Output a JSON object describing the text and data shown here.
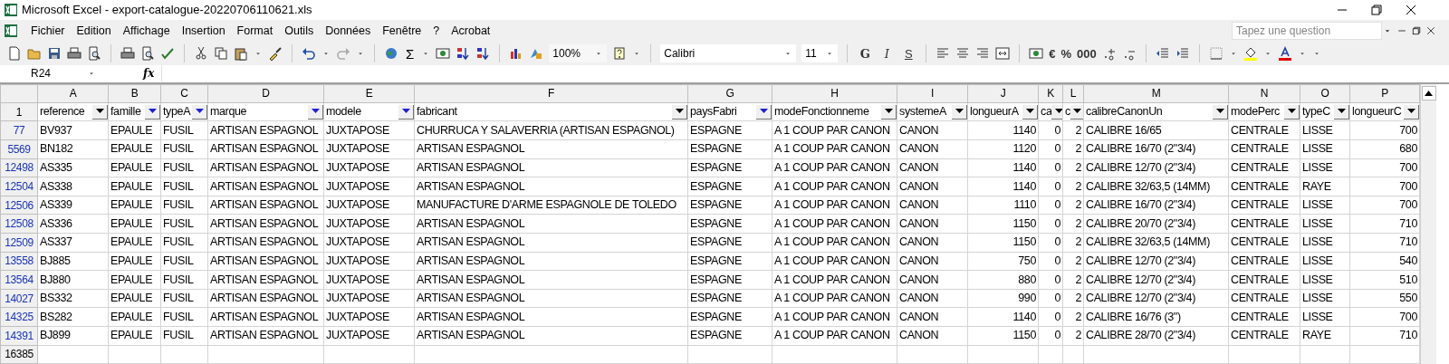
{
  "window": {
    "title": "Microsoft Excel - export-catalogue-20220706110621.xls"
  },
  "menu": [
    "Fichier",
    "Edition",
    "Affichage",
    "Insertion",
    "Format",
    "Outils",
    "Données",
    "Fenêtre",
    "?",
    "Acrobat"
  ],
  "help_search": {
    "placeholder": "Tapez une question"
  },
  "toolbar": {
    "zoom": "100%",
    "sigma": "Σ",
    "font": "Calibri",
    "size": "11",
    "format_buttons": [
      "G",
      "I",
      "S"
    ],
    "number_buttons": [
      "€",
      "%",
      "000"
    ]
  },
  "formula_bar": {
    "name_box": "R24",
    "fx": "fx"
  },
  "columns": [
    {
      "letter": "A",
      "header": "reference",
      "filtered": false,
      "numeric": false
    },
    {
      "letter": "B",
      "header": "famille",
      "filtered": true,
      "numeric": false
    },
    {
      "letter": "C",
      "header": "typeA",
      "filtered": true,
      "numeric": false
    },
    {
      "letter": "D",
      "header": "marque",
      "filtered": true,
      "numeric": false
    },
    {
      "letter": "E",
      "header": "modele",
      "filtered": true,
      "numeric": false
    },
    {
      "letter": "F",
      "header": "fabricant",
      "filtered": false,
      "numeric": false
    },
    {
      "letter": "G",
      "header": "paysFabri",
      "filtered": true,
      "numeric": false
    },
    {
      "letter": "H",
      "header": "modeFonctionneme",
      "filtered": false,
      "numeric": false
    },
    {
      "letter": "I",
      "header": "systemeA",
      "filtered": false,
      "numeric": false
    },
    {
      "letter": "J",
      "header": "longueurA",
      "filtered": false,
      "numeric": true
    },
    {
      "letter": "K",
      "header": "ca",
      "filtered": false,
      "numeric": true
    },
    {
      "letter": "L",
      "header": "c",
      "filtered": false,
      "numeric": true
    },
    {
      "letter": "M",
      "header": "calibreCanonUn",
      "filtered": false,
      "numeric": false
    },
    {
      "letter": "N",
      "header": "modePerc",
      "filtered": false,
      "numeric": false
    },
    {
      "letter": "O",
      "header": "typeC",
      "filtered": false,
      "numeric": false
    },
    {
      "letter": "P",
      "header": "longueurC",
      "filtered": false,
      "numeric": true
    }
  ],
  "header_row": "1",
  "rows": [
    {
      "row": "77",
      "filtered": true,
      "cells": [
        "BV937",
        "EPAULE",
        "FUSIL",
        "ARTISAN ESPAGNOL",
        "JUXTAPOSE",
        "CHURRUCA Y SALAVERRIA (ARTISAN ESPAGNOL)",
        "ESPAGNE",
        "A 1 COUP PAR CANON",
        "CANON",
        "1140",
        "0",
        "2",
        "CALIBRE 16/65",
        "CENTRALE",
        "LISSE",
        "700"
      ]
    },
    {
      "row": "5569",
      "filtered": true,
      "cells": [
        "BN182",
        "EPAULE",
        "FUSIL",
        "ARTISAN ESPAGNOL",
        "JUXTAPOSE",
        "ARTISAN ESPAGNOL",
        "ESPAGNE",
        "A 1 COUP PAR CANON",
        "CANON",
        "1120",
        "0",
        "2",
        "CALIBRE 16/70 (2\"3/4)",
        "CENTRALE",
        "LISSE",
        "680"
      ]
    },
    {
      "row": "12498",
      "filtered": true,
      "cells": [
        "AS335",
        "EPAULE",
        "FUSIL",
        "ARTISAN ESPAGNOL",
        "JUXTAPOSE",
        "ARTISAN ESPAGNOL",
        "ESPAGNE",
        "A 1 COUP PAR CANON",
        "CANON",
        "1140",
        "0",
        "2",
        "CALIBRE 12/70 (2\"3/4)",
        "CENTRALE",
        "LISSE",
        "700"
      ]
    },
    {
      "row": "12504",
      "filtered": true,
      "cells": [
        "AS338",
        "EPAULE",
        "FUSIL",
        "ARTISAN ESPAGNOL",
        "JUXTAPOSE",
        "ARTISAN ESPAGNOL",
        "ESPAGNE",
        "A 1 COUP PAR CANON",
        "CANON",
        "1140",
        "0",
        "2",
        "CALIBRE 32/63,5 (14MM)",
        "CENTRALE",
        "RAYE",
        "700"
      ]
    },
    {
      "row": "12506",
      "filtered": true,
      "cells": [
        "AS339",
        "EPAULE",
        "FUSIL",
        "ARTISAN ESPAGNOL",
        "JUXTAPOSE",
        "MANUFACTURE D'ARME ESPAGNOLE DE TOLEDO",
        "ESPAGNE",
        "A 1 COUP PAR CANON",
        "CANON",
        "1110",
        "0",
        "2",
        "CALIBRE 16/70 (2\"3/4)",
        "CENTRALE",
        "LISSE",
        "700"
      ]
    },
    {
      "row": "12508",
      "filtered": true,
      "cells": [
        "AS336",
        "EPAULE",
        "FUSIL",
        "ARTISAN ESPAGNOL",
        "JUXTAPOSE",
        "ARTISAN ESPAGNOL",
        "ESPAGNE",
        "A 1 COUP PAR CANON",
        "CANON",
        "1150",
        "0",
        "2",
        "CALIBRE 20/70 (2\"3/4)",
        "CENTRALE",
        "LISSE",
        "710"
      ]
    },
    {
      "row": "12509",
      "filtered": true,
      "cells": [
        "AS337",
        "EPAULE",
        "FUSIL",
        "ARTISAN ESPAGNOL",
        "JUXTAPOSE",
        "ARTISAN ESPAGNOL",
        "ESPAGNE",
        "A 1 COUP PAR CANON",
        "CANON",
        "1150",
        "0",
        "2",
        "CALIBRE 32/63,5 (14MM)",
        "CENTRALE",
        "LISSE",
        "710"
      ]
    },
    {
      "row": "13558",
      "filtered": true,
      "cells": [
        "BJ885",
        "EPAULE",
        "FUSIL",
        "ARTISAN ESPAGNOL",
        "JUXTAPOSE",
        "ARTISAN ESPAGNOL",
        "ESPAGNE",
        "A 1 COUP PAR CANON",
        "CANON",
        "750",
        "0",
        "2",
        "CALIBRE 12/70 (2\"3/4)",
        "CENTRALE",
        "LISSE",
        "540"
      ]
    },
    {
      "row": "13564",
      "filtered": true,
      "cells": [
        "BJ880",
        "EPAULE",
        "FUSIL",
        "ARTISAN ESPAGNOL",
        "JUXTAPOSE",
        "ARTISAN ESPAGNOL",
        "ESPAGNE",
        "A 1 COUP PAR CANON",
        "CANON",
        "880",
        "0",
        "2",
        "CALIBRE 12/70 (2\"3/4)",
        "CENTRALE",
        "LISSE",
        "510"
      ]
    },
    {
      "row": "14027",
      "filtered": true,
      "cells": [
        "BS332",
        "EPAULE",
        "FUSIL",
        "ARTISAN ESPAGNOL",
        "JUXTAPOSE",
        "ARTISAN ESPAGNOL",
        "ESPAGNE",
        "A 1 COUP PAR CANON",
        "CANON",
        "990",
        "0",
        "2",
        "CALIBRE 12/70 (2\"3/4)",
        "CENTRALE",
        "LISSE",
        "550"
      ]
    },
    {
      "row": "14325",
      "filtered": true,
      "cells": [
        "BS282",
        "EPAULE",
        "FUSIL",
        "ARTISAN ESPAGNOL",
        "JUXTAPOSE",
        "ARTISAN ESPAGNOL",
        "ESPAGNE",
        "A 1 COUP PAR CANON",
        "CANON",
        "1140",
        "0",
        "2",
        "CALIBRE 16/76 (3\")",
        "CENTRALE",
        "LISSE",
        "700"
      ]
    },
    {
      "row": "14391",
      "filtered": true,
      "cells": [
        "BJ899",
        "EPAULE",
        "FUSIL",
        "ARTISAN ESPAGNOL",
        "JUXTAPOSE",
        "ARTISAN ESPAGNOL",
        "ESPAGNE",
        "A 1 COUP PAR CANON",
        "CANON",
        "1150",
        "0",
        "2",
        "CALIBRE 28/70 (2\"3/4)",
        "CENTRALE",
        "RAYE",
        "710"
      ]
    },
    {
      "row": "16385",
      "filtered": false,
      "cells": []
    }
  ]
}
